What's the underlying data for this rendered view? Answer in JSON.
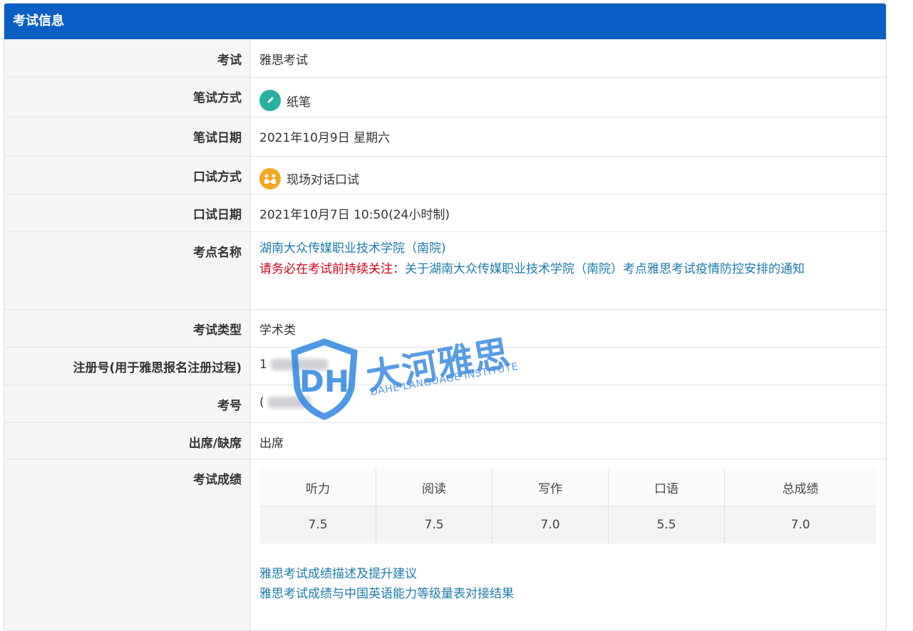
{
  "header": {
    "title": "考试信息"
  },
  "rows": [
    {
      "label": "考试",
      "value": "雅思考试"
    },
    {
      "label": "笔试方式",
      "value": "纸笔",
      "icon": "pencil-icon"
    },
    {
      "label": "笔试日期",
      "value": "2021年10月9日 星期六"
    },
    {
      "label": "口试方式",
      "value": "现场对话口试",
      "icon": "conversation-icon"
    },
    {
      "label": "口试日期",
      "value": "2021年10月7日 10:50(24小时制)"
    },
    {
      "label": "考点名称",
      "value": "湖南大众传媒职业技术学院（南院)"
    },
    {
      "label": "考试类型",
      "value": "学术类"
    },
    {
      "label": "注册号(用于雅思报名注册过程)",
      "value": "1"
    },
    {
      "label": "考号",
      "value": "("
    },
    {
      "label": "出席/缺席",
      "value": "出席"
    },
    {
      "label": "考试成绩"
    }
  ],
  "notice": {
    "prefix": "请务必在考试前持续关注：",
    "link": "关于湖南大众传媒职业技术学院（南院）考点雅思考试疫情防控安排的通知"
  },
  "scores": {
    "headers": [
      "听力",
      "阅读",
      "写作",
      "口语",
      "总成绩"
    ],
    "values": [
      "7.5",
      "7.5",
      "7.0",
      "5.5",
      "7.0"
    ]
  },
  "links": [
    "雅思考试成绩描述及提升建议",
    "雅思考试成绩与中国英语能力等级量表对接结果"
  ],
  "watermark": {
    "cn": "大河雅思",
    "en": "DAHE LANGUAGE INSTITUTE",
    "logo_text": "DH"
  },
  "colors": {
    "header_bg": "#0a5fc5",
    "link": "#1a7bab",
    "warning": "#d0021b",
    "pen_icon_bg": "#2ab0a2",
    "talk_icon_bg": "#f5a623"
  }
}
